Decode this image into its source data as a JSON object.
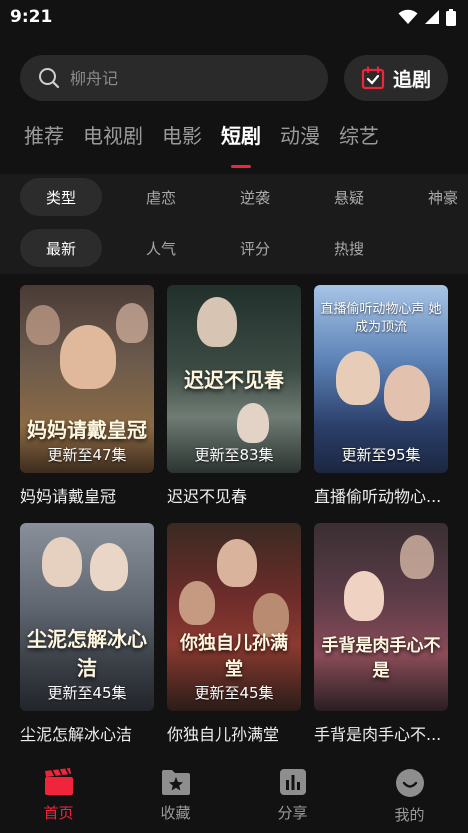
{
  "status_bar": {
    "time": "9:21"
  },
  "search": {
    "placeholder": "柳舟记"
  },
  "follow_button": {
    "label": "追剧"
  },
  "tabs": [
    {
      "label": "推荐",
      "active": false
    },
    {
      "label": "电视剧",
      "active": false
    },
    {
      "label": "电影",
      "active": false
    },
    {
      "label": "短剧",
      "active": true
    },
    {
      "label": "动漫",
      "active": false
    },
    {
      "label": "综艺",
      "active": false
    }
  ],
  "filters": {
    "row1": [
      "类型",
      "虐恋",
      "逆袭",
      "悬疑",
      "神豪"
    ],
    "row2": [
      "最新",
      "人气",
      "评分",
      "热搜"
    ]
  },
  "cards": [
    {
      "title": "妈妈请戴皇冠",
      "episodes": "更新至47集",
      "poster_text": "妈妈请戴皇冠"
    },
    {
      "title": "迟迟不见春",
      "episodes": "更新至83集",
      "poster_text": "迟迟不见春"
    },
    {
      "title": "直播偷听动物心...",
      "episodes": "更新至95集",
      "poster_text": "直播偷听动物心声 她成为顶流"
    },
    {
      "title": "尘泥怎解冰心洁",
      "episodes": "更新至45集",
      "poster_text": "尘泥怎解冰心洁"
    },
    {
      "title": "你独自儿孙满堂",
      "episodes": "更新至45集",
      "poster_text": "你独自儿孙满堂"
    },
    {
      "title": "手背是肉手心不...",
      "episodes": "",
      "poster_text": "手背是肉手心不是"
    }
  ],
  "bottom_nav": [
    {
      "label": "首页",
      "icon": "clapperboard-icon",
      "active": true
    },
    {
      "label": "收藏",
      "icon": "star-folder-icon",
      "active": false
    },
    {
      "label": "分享",
      "icon": "bar-chart-icon",
      "active": false
    },
    {
      "label": "我的",
      "icon": "smile-face-icon",
      "active": false
    }
  ],
  "colors": {
    "accent": "#f0243a",
    "background": "#121212",
    "surface": "#2a2a2a"
  }
}
